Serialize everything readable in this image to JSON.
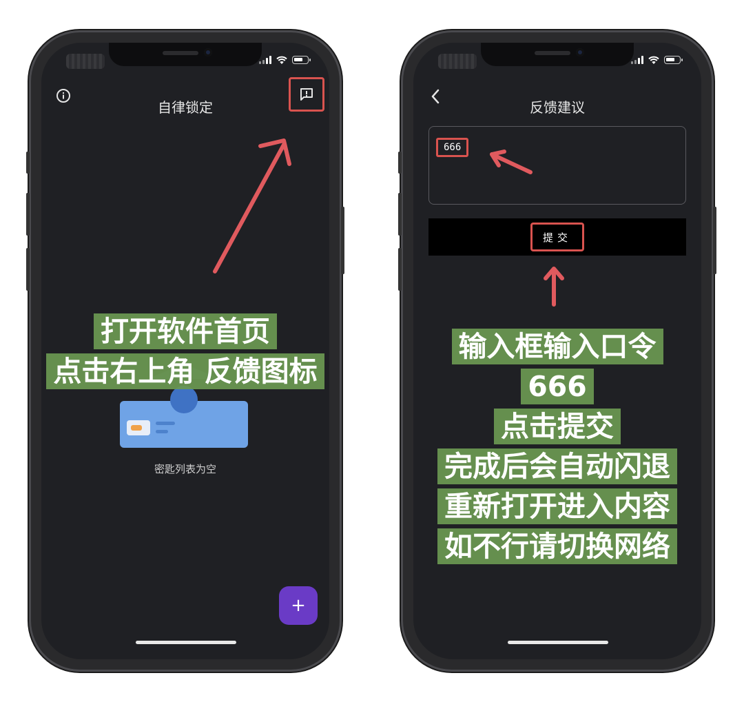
{
  "left_phone": {
    "title": "自律锁定",
    "empty_label": "密匙列表为空",
    "fab_label": "+",
    "overlay_lines": [
      "打开软件首页",
      "点击右上角  反馈图标"
    ]
  },
  "right_phone": {
    "title": "反馈建议",
    "input_value": "666",
    "submit_label": "提交",
    "overlay_lines": [
      "输入框输入口令",
      "666",
      "点击提交",
      "完成后会自动闪退",
      "重新打开进入内容",
      "如不行请切换网络"
    ]
  },
  "icons": {
    "info": "info-circle-icon",
    "feedback": "feedback-icon",
    "back": "chevron-left-icon",
    "add": "plus-icon"
  },
  "colors": {
    "screen_bg": "#1f2024",
    "highlight_red": "#d9534f",
    "overlay_green": "#6b9852",
    "fab_purple": "#6a3bc6"
  }
}
